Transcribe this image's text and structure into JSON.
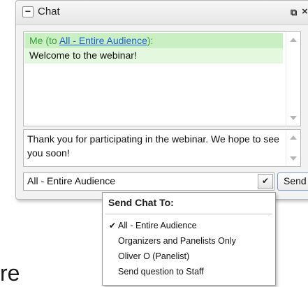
{
  "chat": {
    "title": "Chat",
    "icons": {
      "collapse": "−",
      "popout": "⧉",
      "close": "×"
    },
    "message": {
      "sender": "Me",
      "to_prefix": " (to ",
      "recipient_link": "All - Entire Audience",
      "to_suffix": "):",
      "text": "Welcome to the webinar!"
    },
    "composer": {
      "value": "Thank you for participating in the webinar. We hope to see you soon!"
    },
    "recipient": {
      "selected": "All - Entire Audience",
      "dropdown_glyph": "✔"
    },
    "send_label": "Send"
  },
  "menu": {
    "header": "Send Chat To:",
    "items": [
      {
        "label": "All - Entire Audience",
        "checked": true
      },
      {
        "label": "Organizers and Panelists Only",
        "checked": false
      },
      {
        "label": "Oliver O (Panelist)",
        "checked": false
      },
      {
        "label": "Send question to Staff",
        "checked": false
      }
    ],
    "check_glyph": "✔"
  },
  "fragment_text": "re",
  "colors": {
    "message_header_bg": "#c9efc2",
    "message_body_bg": "#e3f8de",
    "sender_text": "#3aa13a",
    "link": "#1a5fd6"
  }
}
